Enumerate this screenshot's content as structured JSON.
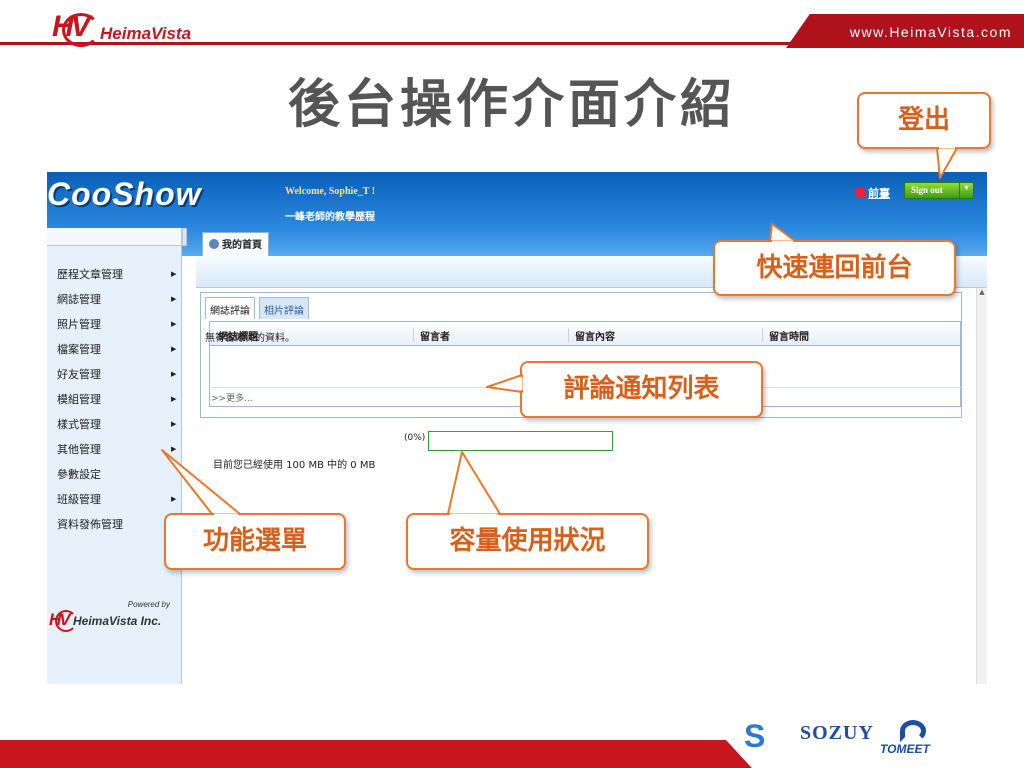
{
  "slide": {
    "title": "後台操作介面介紹",
    "website": "www.HeimaVista.com",
    "logo_mark": "HV",
    "logo_word": "HeimaVista"
  },
  "app": {
    "brand": "CooShow",
    "welcome": "Welcome, Sophie_T !",
    "subtitle": "一峰老師的教學歷程",
    "home_link": "前臺",
    "sign_out": "Sign out",
    "sign_out_caret": "▾",
    "main_tab": "我的首頁",
    "sidebar": {
      "items": [
        {
          "label": "歷程文章管理",
          "arrow": "▶"
        },
        {
          "label": "網誌管理",
          "arrow": "▶"
        },
        {
          "label": "照片管理",
          "arrow": "▶"
        },
        {
          "label": "檔案管理",
          "arrow": "▶"
        },
        {
          "label": "好友管理",
          "arrow": "▶"
        },
        {
          "label": "模組管理",
          "arrow": "▶"
        },
        {
          "label": "樣式管理",
          "arrow": "▶"
        },
        {
          "label": "其他管理",
          "arrow": "▶"
        },
        {
          "label": "參數設定",
          "arrow": ""
        },
        {
          "label": "班級管理",
          "arrow": "▶"
        },
        {
          "label": "資料發佈管理",
          "arrow": ""
        }
      ],
      "powered_by": "Powered by",
      "powered_mark": "HV",
      "powered_name": "HeimaVista Inc."
    },
    "comments": {
      "tabs": [
        "網誌評論",
        "相片評論"
      ],
      "columns": [
        "網誌標題",
        "留言者",
        "留言內容",
        "留言時間"
      ],
      "empty_text": "無符合條件的資料。",
      "more_link": ">>更多..."
    },
    "usage": {
      "percent_label": "(0%)",
      "fraction": 0,
      "text": "目前您已經使用 100 MB 中的 0 MB"
    }
  },
  "callouts": {
    "logout": "登出",
    "frontend": "快速連回前台",
    "comment_list": "評論通知列表",
    "function_menu": "功能選單",
    "capacity": "容量使用狀況"
  },
  "footer": {
    "logo_s": "S",
    "sozuy": "SOZUY",
    "tomeet": "TOMEET"
  },
  "colors": {
    "brand_red": "#c8161d",
    "callout_orange": "#e9782c",
    "app_blue": "#1f77d0",
    "usage_green": "#2fa23a"
  }
}
